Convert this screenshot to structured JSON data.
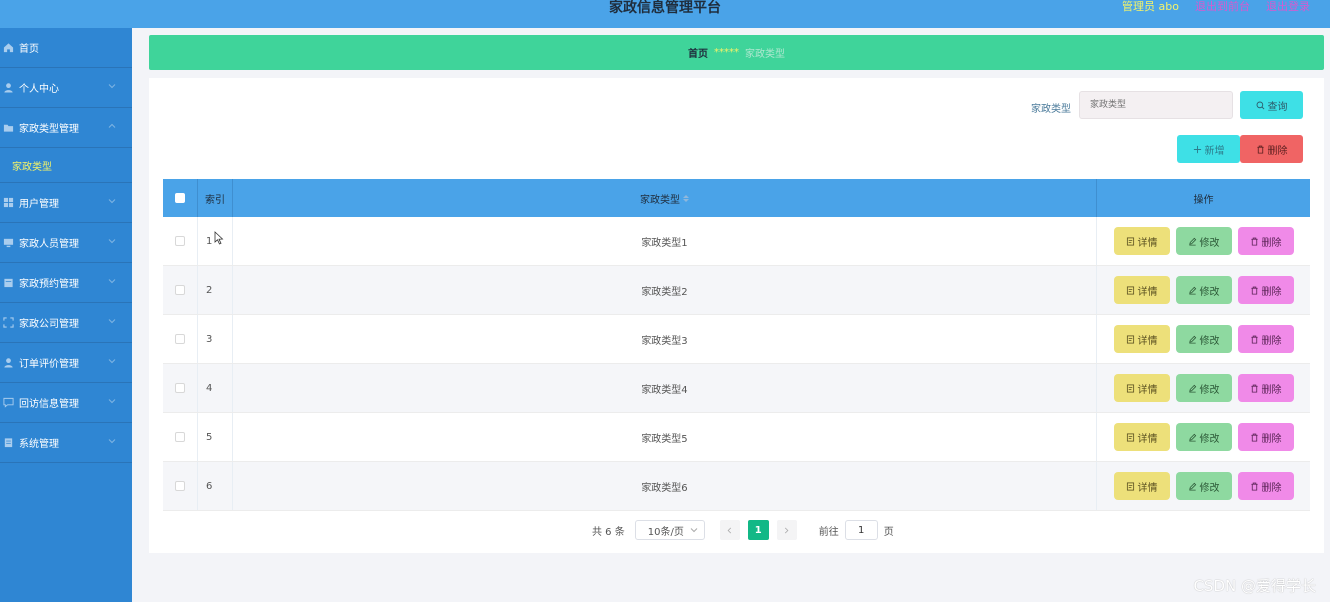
{
  "header": {
    "title": "家政信息管理平台",
    "admin": "管理员 abo",
    "front": "退出到前台",
    "logout": "退出登录"
  },
  "sidebar": {
    "items": [
      {
        "label": "首页",
        "icon": "home-icon",
        "arrow": false
      },
      {
        "label": "个人中心",
        "icon": "user-icon",
        "arrow": true
      },
      {
        "label": "家政类型管理",
        "icon": "folder-icon",
        "arrow": true
      },
      {
        "label": "用户管理",
        "icon": "grid-icon",
        "arrow": true
      },
      {
        "label": "家政人员管理",
        "icon": "monitor-icon",
        "arrow": true
      },
      {
        "label": "家政预约管理",
        "icon": "calendar-icon",
        "arrow": true
      },
      {
        "label": "家政公司管理",
        "icon": "frame-icon",
        "arrow": true
      },
      {
        "label": "订单评价管理",
        "icon": "user-icon",
        "arrow": true
      },
      {
        "label": "回访信息管理",
        "icon": "chat-icon",
        "arrow": true
      },
      {
        "label": "系统管理",
        "icon": "settings-icon",
        "arrow": true
      }
    ],
    "sub_item": "家政类型"
  },
  "breadcrumb": {
    "home": "首页",
    "stars": "*****",
    "current": "家政类型"
  },
  "search": {
    "label": "家政类型",
    "placeholder": "家政类型",
    "query": "查询"
  },
  "actions": {
    "add": "新增",
    "delete": "删除"
  },
  "table": {
    "headers": {
      "index": "索引",
      "type": "家政类型",
      "ops": "操作"
    },
    "rows": [
      {
        "index": "1",
        "type": "家政类型1"
      },
      {
        "index": "2",
        "type": "家政类型2"
      },
      {
        "index": "3",
        "type": "家政类型3"
      },
      {
        "index": "4",
        "type": "家政类型4"
      },
      {
        "index": "5",
        "type": "家政类型5"
      },
      {
        "index": "6",
        "type": "家政类型6"
      }
    ],
    "ops": {
      "detail": "详情",
      "edit": "修改",
      "delete": "删除"
    }
  },
  "pager": {
    "total": "共 6 条",
    "size": "10条/页",
    "page": "1",
    "goto": "前往",
    "goto_value": "1",
    "unit": "页"
  },
  "watermark": "CSDN @爱得学长",
  "colors": {
    "header": "#4aa3e8",
    "sidebar": "#2f86d3",
    "breadcrumb": "#3fd49a",
    "accent": "#12b886"
  }
}
